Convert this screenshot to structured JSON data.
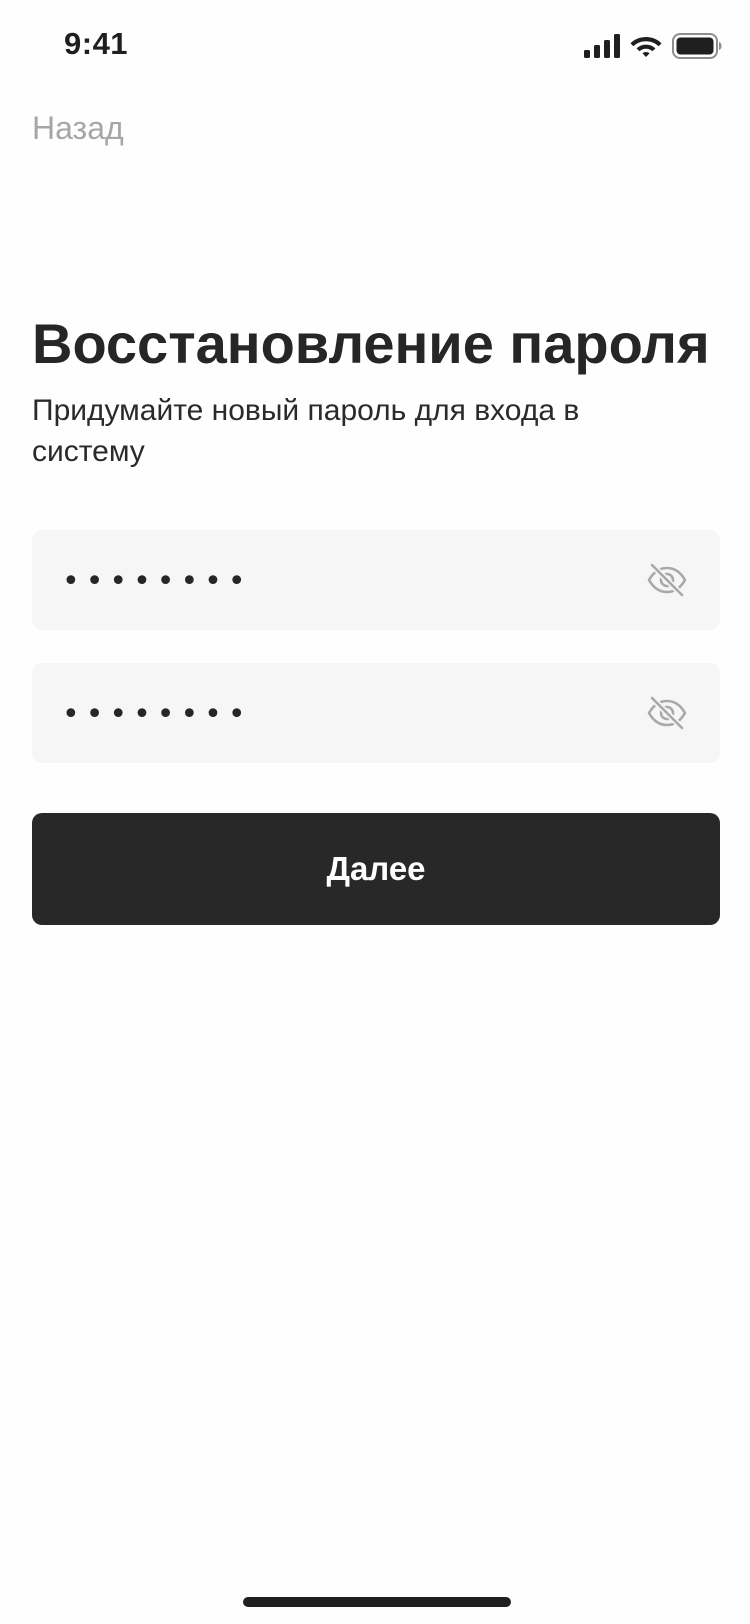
{
  "status_bar": {
    "time": "9:41",
    "icons": [
      "signal-icon",
      "wifi-icon",
      "battery-icon"
    ]
  },
  "nav": {
    "back_label": "Назад"
  },
  "header": {
    "title": "Восстановление пароля",
    "subtitle": "Придумайте новый пароль для входа в систему"
  },
  "form": {
    "password": {
      "value": "••••••••",
      "toggle_icon": "eye-off-icon"
    },
    "confirm_password": {
      "value": "••••••••",
      "toggle_icon": "eye-off-icon"
    },
    "submit_label": "Далее"
  },
  "colors": {
    "primary": "#282829",
    "field_background": "#f6f6f7",
    "muted_text": "#a6a6a8",
    "icon_muted": "#a9a9ab"
  }
}
